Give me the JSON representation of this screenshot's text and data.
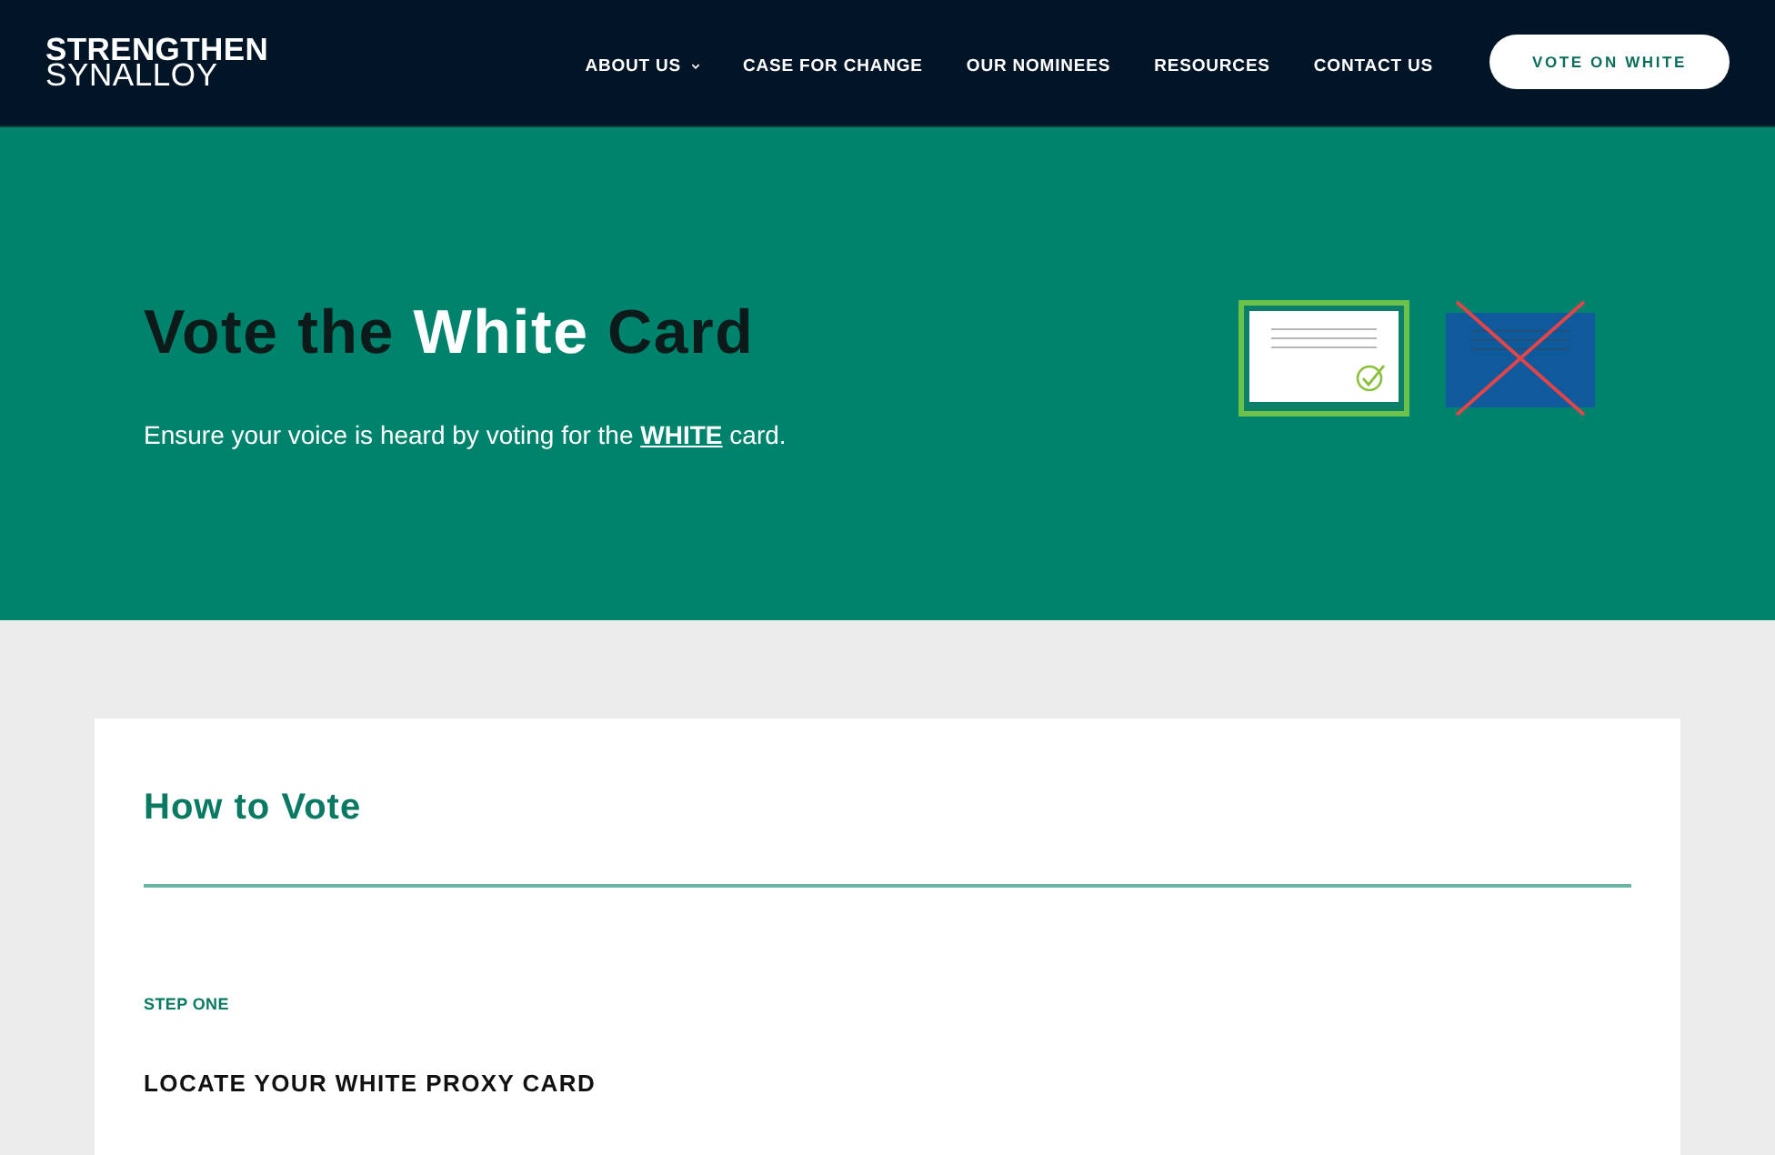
{
  "header": {
    "logo": {
      "line_1": "STRENGTHEN",
      "line_2": "SYNALLOY"
    },
    "nav": [
      {
        "label": "ABOUT US",
        "dropdown": true
      },
      {
        "label": "CASE FOR CHANGE",
        "dropdown": false
      },
      {
        "label": "OUR NOMINEES",
        "dropdown": false
      },
      {
        "label": "RESOURCES",
        "dropdown": false
      },
      {
        "label": "CONTACT US",
        "dropdown": false
      }
    ],
    "cta_button": "VOTE ON WHITE"
  },
  "hero": {
    "title": [
      {
        "text": "Vote the ",
        "highlight": false
      },
      {
        "text": "White",
        "highlight": true
      },
      {
        "text": " Card",
        "highlight": false
      }
    ],
    "subtitle": {
      "before": "Ensure your voice is heard by voting for the ",
      "link": "WHITE",
      "after": " card."
    }
  },
  "how_to_vote": {
    "heading": "How to Vote",
    "steps": [
      {
        "label": "STEP ONE",
        "title": "LOCATE YOUR WHITE PROXY CARD"
      }
    ]
  }
}
